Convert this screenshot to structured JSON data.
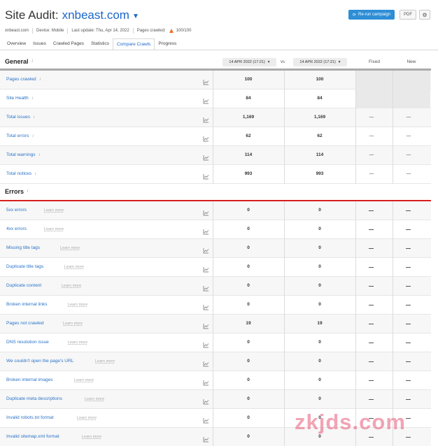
{
  "header": {
    "title_prefix": "Site Audit:",
    "domain": "xnbeast.com",
    "rerun_label": "Re-run campaign",
    "pdf_label": "PDF",
    "gear_icon": "gear-icon"
  },
  "meta": {
    "site": "xnbeast.com",
    "device": "Device: Mobile",
    "last_update": "Last update: Thu, Apr 14, 2022",
    "pages_crawled_label": "Pages crawled:",
    "pages_crawled_value": "100/100"
  },
  "tabs": [
    {
      "label": "Overview",
      "active": false
    },
    {
      "label": "Issues",
      "active": false
    },
    {
      "label": "Crawled Pages",
      "active": false
    },
    {
      "label": "Statistics",
      "active": false
    },
    {
      "label": "Compare Crawls",
      "active": true
    },
    {
      "label": "Progress",
      "active": false
    }
  ],
  "compare": {
    "date_left": "14 APR 2022 (17:21)",
    "date_right": "14 APR 2022 (17:21)",
    "vs": "vs",
    "fixed_label": "Fixed",
    "new_label": "New"
  },
  "general": {
    "title": "General",
    "rows": [
      {
        "name": "Pages crawled",
        "left": "100",
        "right": "100",
        "fixed": "",
        "new": "",
        "empty": true
      },
      {
        "name": "Site Health",
        "left": "84",
        "right": "84",
        "fixed": "",
        "new": "",
        "empty": true
      },
      {
        "name": "Total issues",
        "left": "1,169",
        "right": "1,169",
        "fixed": "—",
        "new": "—",
        "empty": false
      },
      {
        "name": "Total errors",
        "left": "62",
        "right": "62",
        "fixed": "—",
        "new": "—",
        "empty": false
      },
      {
        "name": "Total warnings",
        "left": "114",
        "right": "114",
        "fixed": "—",
        "new": "—",
        "empty": false
      },
      {
        "name": "Total notices",
        "left": "993",
        "right": "993",
        "fixed": "—",
        "new": "—",
        "empty": false
      }
    ]
  },
  "errors": {
    "title": "Errors",
    "learn_more": "Learn more",
    "rows": [
      {
        "name": "5xx errors",
        "left": "0",
        "right": "0"
      },
      {
        "name": "4xx errors",
        "left": "0",
        "right": "0"
      },
      {
        "name": "Missing title tags",
        "left": "0",
        "right": "0"
      },
      {
        "name": "Duplicate title tags",
        "left": "0",
        "right": "0"
      },
      {
        "name": "Duplicate content",
        "left": "0",
        "right": "0"
      },
      {
        "name": "Broken internal links",
        "left": "0",
        "right": "0"
      },
      {
        "name": "Pages not crawled",
        "left": "19",
        "right": "19"
      },
      {
        "name": "DNS resolution issue",
        "left": "0",
        "right": "0"
      },
      {
        "name": "We couldn't open the page's URL",
        "left": "0",
        "right": "0"
      },
      {
        "name": "Broken internal images",
        "left": "0",
        "right": "0"
      },
      {
        "name": "Duplicate meta descriptions",
        "left": "0",
        "right": "0"
      },
      {
        "name": "Invalid robots.txt format",
        "left": "0",
        "right": "0"
      },
      {
        "name": "Invalid sitemap.xml format",
        "left": "0",
        "right": "0"
      }
    ]
  },
  "watermark": "zkjds.com",
  "colors": {
    "accent": "#1b66c9",
    "button": "#2e8ed6",
    "error_line": "#d91e1e",
    "warning": "#f06d28"
  }
}
